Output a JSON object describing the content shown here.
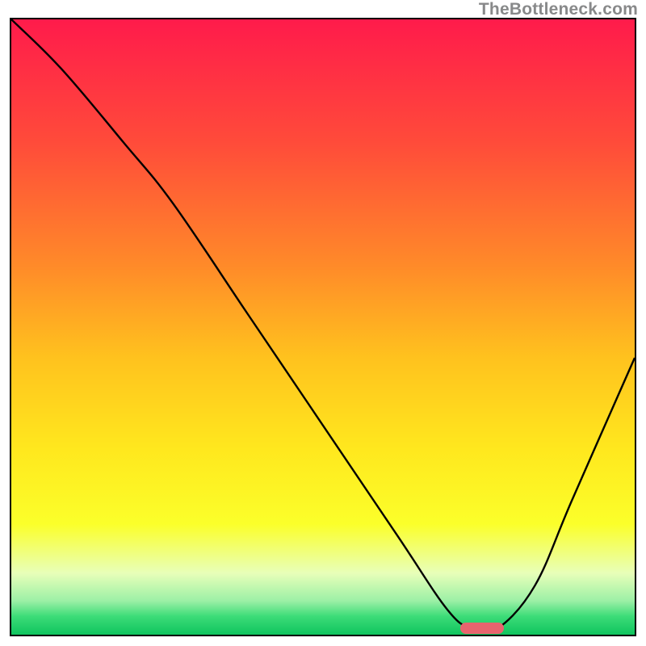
{
  "watermark": "TheBottleneck.com",
  "chart_data": {
    "type": "line",
    "title": "",
    "xlabel": "",
    "ylabel": "",
    "xlim": [
      0,
      100
    ],
    "ylim": [
      0,
      100
    ],
    "gradient_stops": [
      {
        "offset": 0.0,
        "color": "#ff1b4b"
      },
      {
        "offset": 0.2,
        "color": "#ff4b3a"
      },
      {
        "offset": 0.4,
        "color": "#ff8a29"
      },
      {
        "offset": 0.55,
        "color": "#ffc21e"
      },
      {
        "offset": 0.7,
        "color": "#ffe81e"
      },
      {
        "offset": 0.82,
        "color": "#fbff2a"
      },
      {
        "offset": 0.9,
        "color": "#e8ffb9"
      },
      {
        "offset": 0.945,
        "color": "#9cf0a6"
      },
      {
        "offset": 0.97,
        "color": "#3ddc78"
      },
      {
        "offset": 1.0,
        "color": "#0fc45e"
      }
    ],
    "series": [
      {
        "name": "bottleneck-curve",
        "x": [
          0,
          8,
          18,
          26,
          38,
          50,
          62,
          70,
          74,
          78,
          84,
          90,
          100
        ],
        "values": [
          100,
          92,
          80,
          70,
          52,
          34,
          16,
          4,
          1,
          1,
          8,
          22,
          45
        ]
      }
    ],
    "marker": {
      "name": "optimal-range",
      "x_start": 72,
      "x_end": 79,
      "y": 1,
      "color": "#e8646e"
    }
  }
}
